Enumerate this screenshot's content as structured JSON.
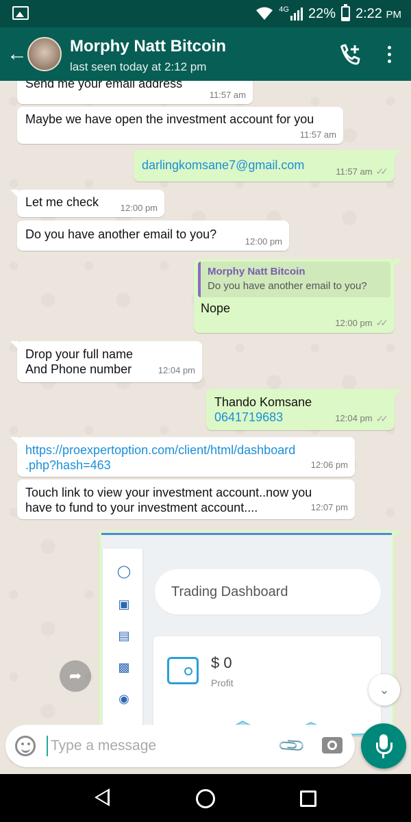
{
  "status_bar": {
    "network": "4G",
    "battery": "22%",
    "time": "2:22",
    "ampm": "PM"
  },
  "header": {
    "contact_name": "Morphy Natt Bitcoin",
    "last_seen": "last seen today at 2:12 pm"
  },
  "messages": [
    {
      "text": "Send me your email address",
      "time": "11:57 am"
    },
    {
      "text": "Maybe we have open the investment account for you",
      "time": "11:57 am"
    },
    {
      "text": "darlingkomsane7@gmail.com",
      "time": "11:57 am"
    },
    {
      "text": "Let me check",
      "time": "12:00 pm"
    },
    {
      "text": "Do you have another email to you?",
      "time": "12:00 pm"
    },
    {
      "quote_author": "Morphy Natt Bitcoin",
      "quote_text": "Do you have another email to you?",
      "text": "Nope",
      "time": "12:00 pm"
    },
    {
      "line1": "Drop your full name",
      "line2": "And Phone number",
      "time": "12:04 pm"
    },
    {
      "line1": "Thando Komsane",
      "line2": "0641719683",
      "time": "12:04 pm"
    },
    {
      "line1": "https://proexpertoption.com/client/html/dashboard",
      "line2": ".php?hash=463",
      "time": "12:06 pm"
    },
    {
      "line1": "Touch link to view your investment account..now you",
      "line2": "have to fund to your investment account....",
      "time": "12:07 pm"
    }
  ],
  "image_message": {
    "title": "Trading Dashboard",
    "profit_value": "$ 0",
    "profit_label": "Profit"
  },
  "composer": {
    "placeholder": "Type a message"
  },
  "colors": {
    "header": "#075e54",
    "status_bar": "#054d44",
    "outgoing_bubble": "#dcf8c6",
    "link": "#1a8fd8",
    "mic_button": "#00897b"
  }
}
